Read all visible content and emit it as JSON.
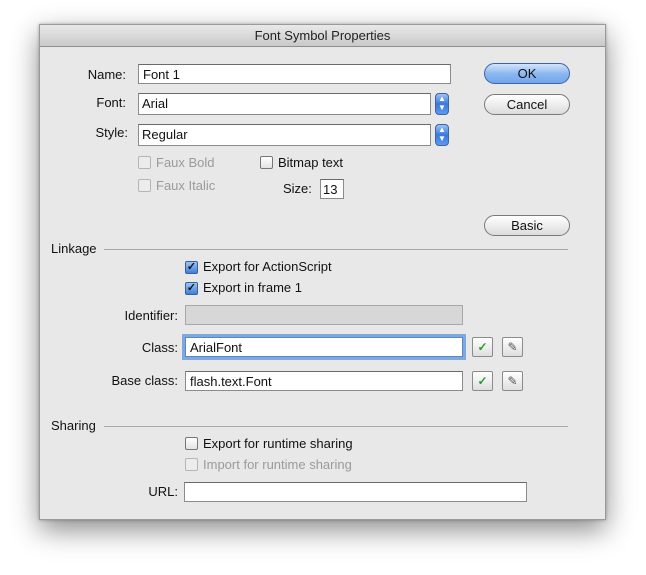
{
  "window": {
    "title": "Font Symbol Properties"
  },
  "labels": {
    "name": "Name:",
    "font": "Font:",
    "style": "Style:",
    "faux_bold": "Faux Bold",
    "faux_italic": "Faux Italic",
    "bitmap_text": "Bitmap text",
    "size": "Size:",
    "linkage": "Linkage",
    "export_actionscript": "Export for ActionScript",
    "export_frame1": "Export in frame 1",
    "identifier": "Identifier:",
    "class": "Class:",
    "base_class": "Base class:",
    "sharing": "Sharing",
    "export_runtime": "Export for runtime sharing",
    "import_runtime": "Import for runtime sharing",
    "url": "URL:"
  },
  "fields": {
    "name": "Font 1",
    "font": "Arial",
    "style": "Regular",
    "size": "13",
    "identifier": "",
    "class": "ArialFont",
    "base_class": "flash.text.Font",
    "url": ""
  },
  "buttons": {
    "ok": "OK",
    "cancel": "Cancel",
    "basic": "Basic"
  },
  "checks": {
    "faux_bold": false,
    "faux_italic": false,
    "bitmap_text": false,
    "export_actionscript": true,
    "export_frame1": true,
    "export_runtime": false,
    "import_runtime": false
  },
  "icons": {
    "stepper": "popup-arrows-icon",
    "validate": "checkmark-icon",
    "edit": "pencil-icon"
  },
  "colors": {
    "accent": "#3a79d8",
    "validate": "#2e9a2e"
  }
}
